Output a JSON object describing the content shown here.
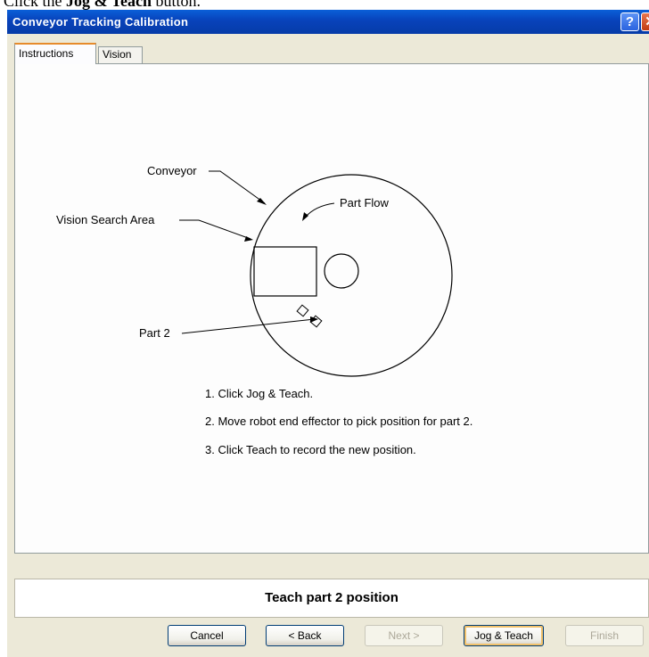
{
  "top_fragment": {
    "prefix": "Click the ",
    "bold": "Jog & Teach",
    "suffix": " button."
  },
  "window": {
    "title": "Conveyor Tracking Calibration",
    "help_glyph": "?",
    "close_glyph": "✕"
  },
  "tabs": [
    {
      "label": "Instructions",
      "selected": true
    },
    {
      "label": "Vision",
      "selected": false
    }
  ],
  "diagram": {
    "labels": {
      "conveyor": "Conveyor",
      "part_flow": "Part Flow",
      "vision_search_area": "Vision Search Area",
      "part2": "Part 2"
    }
  },
  "instructions": [
    "1. Click Jog & Teach.",
    "2. Move robot end effector to pick position for part 2.",
    "3. Click Teach to record the new position."
  ],
  "status": "Teach part 2 position",
  "buttons": {
    "cancel": "Cancel",
    "back": "< Back",
    "next": "Next >",
    "jog_teach": "Jog & Teach",
    "finish": "Finish"
  },
  "colors": {
    "titlebar": "#0842ba",
    "dialog_bg": "#ece9d8",
    "tab_accent": "#e68b2c"
  }
}
